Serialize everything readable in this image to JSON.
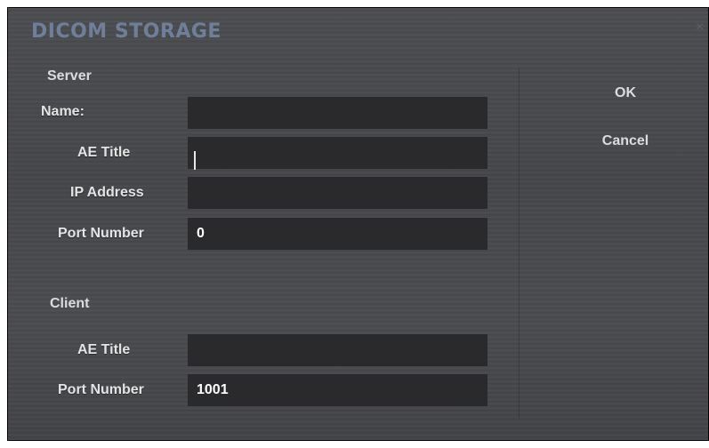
{
  "dialog": {
    "title": "DICOM STORAGE",
    "close_glyph": "×"
  },
  "server": {
    "section_title": "Server",
    "name_label": "Name:",
    "name_value": "",
    "ae_title_label": "AE Title",
    "ae_title_value": "",
    "ip_address_label": "IP Address",
    "ip_address_value": "",
    "port_number_label": "Port Number",
    "port_number_value": "0"
  },
  "client": {
    "section_title": "Client",
    "ae_title_label": "AE Title",
    "ae_title_value": "",
    "port_number_label": "Port Number",
    "port_number_value": "1001"
  },
  "actions": {
    "ok_label": "OK",
    "cancel_label": "Cancel"
  },
  "icons": {
    "close": "close-icon"
  },
  "colors": {
    "title": "#6f7f9a",
    "background": "#4a4b4e",
    "input_background": "#2a2a2c",
    "text": "#e4e4e4"
  }
}
